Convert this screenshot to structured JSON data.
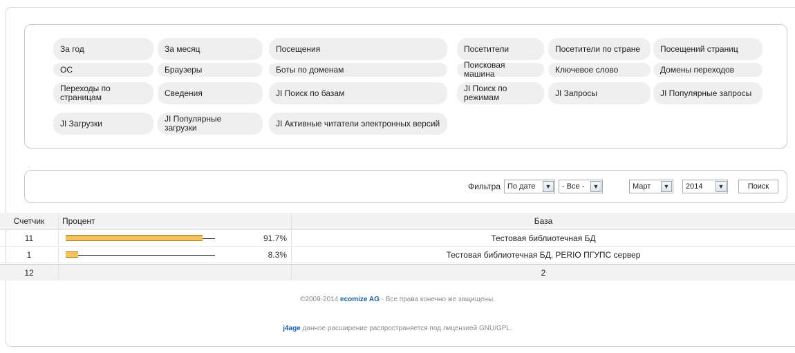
{
  "menu": {
    "items": [
      "За год",
      "За месяц",
      "Посещения",
      "Посетители",
      "Посетители по стране",
      "Посещений страниц",
      "ОС",
      "Браузеры",
      "Боты по доменам",
      "Поисковая машина",
      "Ключевое слово",
      "Домены переходов",
      "Переходы по страницам",
      "Сведения",
      "JI Поиск по базам",
      "JI Поиск по режимам",
      "JI Запросы",
      "JI Популярные запросы",
      "JI Загрузки",
      "JI Популярные загрузки",
      "JI Активные читатели электронных версий"
    ]
  },
  "filter": {
    "label": "Фильтра",
    "by": "По дате",
    "all": "- Все -",
    "month": "Март",
    "year": "2014",
    "search_label": "Поиск"
  },
  "table": {
    "headers": {
      "count": "Счетчик",
      "percent": "Процент",
      "base": "База"
    },
    "rows": [
      {
        "count": "11",
        "percent": "91.7%",
        "fraction": 0.917,
        "base": "Тестовая библиотечная БД"
      },
      {
        "count": "1",
        "percent": "8.3%",
        "fraction": 0.083,
        "base": "Тестовая библиотечная БД, PERIO ПГУПС сервер"
      }
    ],
    "total": {
      "count": "12",
      "base": "2"
    }
  },
  "footer": {
    "copyright_prefix": "©2009-2014 ",
    "company": "ecomize AG",
    "copyright_suffix": " - Все права конечно же защищены.",
    "ext_name": "j4age",
    "ext_text": " данное расширение распространяется под лицензией GNU/GPL."
  },
  "colors": {
    "bar_fill": "#f5c25a",
    "link": "#1d5fa0"
  }
}
